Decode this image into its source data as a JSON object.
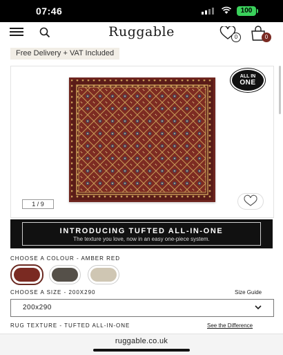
{
  "status": {
    "time": "07:46",
    "battery": "100"
  },
  "header": {
    "brand": "Ruggable",
    "wishlist_count": "0",
    "cart_count": "0"
  },
  "promo": {
    "text": "Free Delivery + VAT Included"
  },
  "gallery": {
    "badge_line1": "ALL IN",
    "badge_line2": "ONE",
    "pager": "1 / 9"
  },
  "banner": {
    "title": "INTRODUCING TUFTED ALL-IN-ONE",
    "subtitle": "The texture you love, now in an easy one-piece system."
  },
  "colour": {
    "label": "CHOOSE A COLOUR - AMBER RED",
    "swatches": [
      {
        "name": "amber-red",
        "color": "#7a2a22",
        "selected": true
      },
      {
        "name": "charcoal",
        "color": "#555049",
        "selected": false
      },
      {
        "name": "cream",
        "color": "#cfc6b3",
        "selected": false
      }
    ]
  },
  "size": {
    "label": "CHOOSE A SIZE - 200X290",
    "guide": "Size Guide",
    "selected": "200x290"
  },
  "texture": {
    "label": "RUG TEXTURE - TUFTED ALL-IN-ONE",
    "link": "See the Difference"
  },
  "browser": {
    "url": "ruggable.co.uk"
  },
  "colors": {
    "accent": "#7a2a22",
    "banner_bg": "#111111",
    "promo_bg": "#f2eee6"
  }
}
